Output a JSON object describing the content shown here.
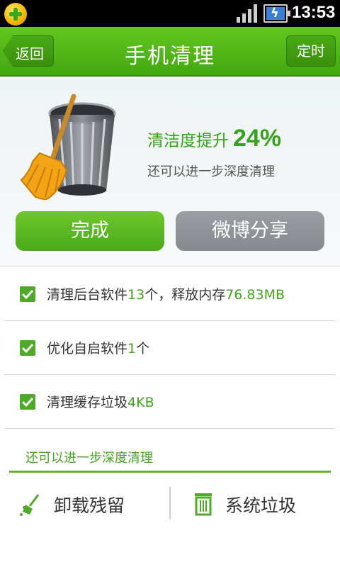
{
  "status_bar": {
    "time": "13:53",
    "app_icon": "360-plus-icon",
    "signal_icon": "signal-icon",
    "battery_icon": "battery-charging-icon"
  },
  "title_bar": {
    "back_label": "返回",
    "title": "手机清理",
    "timer_label": "定时"
  },
  "hero": {
    "image_icon": "broom-trash-can-icon",
    "score_text": "清洁度提升",
    "score_value": "24%",
    "subtitle": "还可以进一步深度清理",
    "done_label": "完成",
    "share_label": "微博分享"
  },
  "results": [
    {
      "pre": "清理后台软件",
      "num1": "13",
      "mid": "个，释放内存",
      "num2": "76.83MB",
      "post": "",
      "checked": true
    },
    {
      "pre": "优化自启软件",
      "num1": "1",
      "mid": "个",
      "num2": "",
      "post": "",
      "checked": true
    },
    {
      "pre": "清理缓存垃圾",
      "num1": "4KB",
      "mid": "",
      "num2": "",
      "post": "",
      "checked": true
    }
  ],
  "deep_clean": {
    "section_label": "还可以进一步深度清理",
    "tools": [
      {
        "label": "卸载残留",
        "icon": "broom-icon"
      },
      {
        "label": "系统垃圾",
        "icon": "trash-icon"
      }
    ]
  },
  "colors": {
    "brand_green": "#4aa91a",
    "accent_text_green": "#44a51f",
    "share_gray": "#8e9297"
  }
}
